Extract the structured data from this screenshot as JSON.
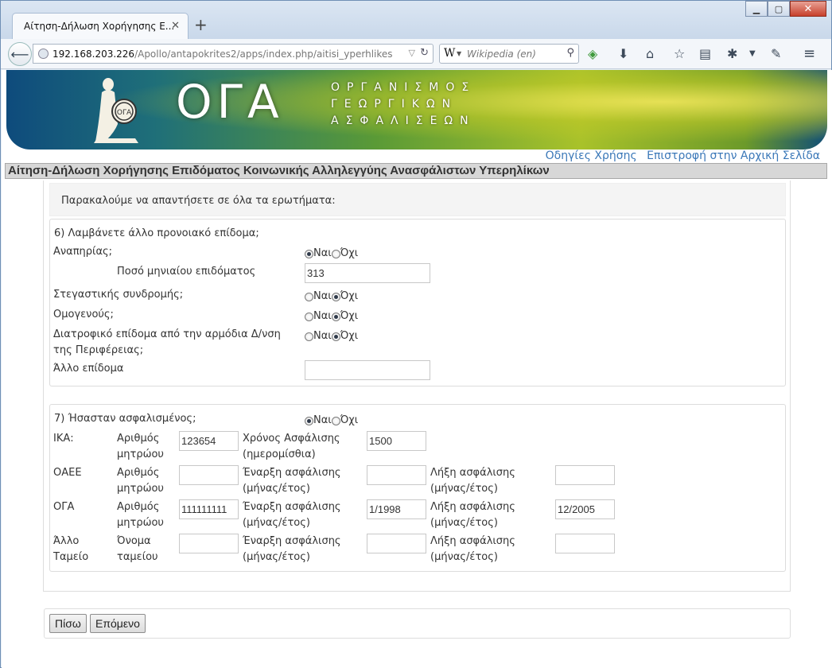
{
  "browser": {
    "tab_title": "Αίτηση-Δήλωση Χορήγησης Ε...",
    "url_host": "192.168.203.226",
    "url_path": "/Apollo/antapokrites2/apps/index.php/aitisi_yperhlikes",
    "search_placeholder": "Wikipedia (en)",
    "search_engine_glyph": "W"
  },
  "banner": {
    "logo": "ΟΓΑ",
    "subtitle_line1": "ΟΡΓΑΝΙΣΜΟΣ",
    "subtitle_line2": "ΓΕΩΡΓΙΚΩΝ",
    "subtitle_line3": "ΑΣΦΑΛΙΣΕΩΝ",
    "seal_text": "ΟΓΑ"
  },
  "links": {
    "help": "Οδηγίες Χρήσης",
    "home": "Επιστροφή στην Αρχική Σελίδα"
  },
  "page_title": "Αίτηση-Δήλωση Χορήγησης Επιδόματος Κοινωνικής Αλληλεγγύης Ανασφάλιστων Υπερηλίκων",
  "notice": "Παρακαλούμε να απαντήσετε σε όλα τα ερωτήματα:",
  "radio_labels": {
    "yes": "Ναι",
    "no": "Όχι"
  },
  "q6": {
    "title": "6) Λαμβάνετε άλλο προνοιακό επίδομα;",
    "disability": {
      "label": "Αναπηρίας;",
      "value": "yes"
    },
    "monthly_amount": {
      "label": "Ποσό μηνιαίου επιδόματος",
      "value": "313"
    },
    "housing": {
      "label": "Στεγαστικής συνδρομής;",
      "value": "no"
    },
    "expatriate": {
      "label": "Ομογενούς;",
      "value": "no"
    },
    "food": {
      "label_line1": "Διατροφικό επίδομα από την αρμόδια Δ/νση",
      "label_line2": "της Περιφέρειας;",
      "value": "no"
    },
    "other": {
      "label": "Άλλο επίδομα",
      "value": ""
    }
  },
  "q7": {
    "title": "7) Ήσασταν ασφαλισμένος;",
    "value": "yes",
    "ika": {
      "label": "ΙΚΑ:",
      "reg_label_1": "Αριθμός",
      "reg_label_2": "μητρώου",
      "reg_value": "123654",
      "time_label_1": "Χρόνος Ασφάλισης",
      "time_label_2": "(ημερομίσθια)",
      "time_value": "1500"
    },
    "oaee": {
      "label": "ΟΑΕΕ",
      "reg_label_1": "Αριθμός",
      "reg_label_2": "μητρώου",
      "reg_value": "",
      "start_label_1": "Έναρξη ασφάλισης",
      "start_label_2": "(μήνας/έτος)",
      "start_value": "",
      "end_label_1": "Λήξη ασφάλισης",
      "end_label_2": "(μήνας/έτος)",
      "end_value": ""
    },
    "oga": {
      "label": "ΟΓΑ",
      "reg_label_1": "Αριθμός",
      "reg_label_2": "μητρώου",
      "reg_value": "111111111",
      "start_label_1": "Έναρξη ασφάλισης",
      "start_label_2": "(μήνας/έτος)",
      "start_value": "1/1998",
      "end_label_1": "Λήξη ασφάλισης",
      "end_label_2": "(μήνας/έτος)",
      "end_value": "12/2005"
    },
    "other": {
      "label_1": "Άλλο",
      "label_2": "Ταμείο",
      "name_label_1": "Όνομα",
      "name_label_2": "ταμείου",
      "name_value": "",
      "start_label_1": "Έναρξη ασφάλισης",
      "start_label_2": "(μήνας/έτος)",
      "start_value": "",
      "end_label_1": "Λήξη ασφάλισης",
      "end_label_2": "(μήνας/έτος)",
      "end_value": ""
    }
  },
  "buttons": {
    "back": "Πίσω",
    "next": "Επόμενο"
  }
}
